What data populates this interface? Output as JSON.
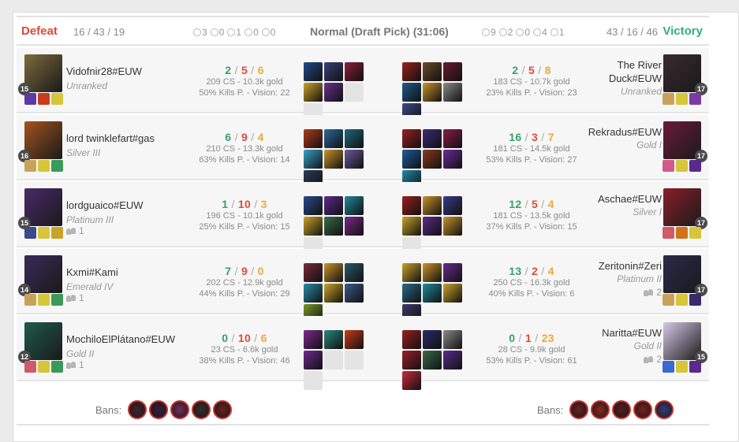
{
  "header": {
    "left_result": "Defeat",
    "left_kda": "16 / 43 / 19",
    "left_objectives": [
      "3",
      "0",
      "1",
      "0",
      "0"
    ],
    "game_mode": "Normal (Draft Pick) (31:06)",
    "right_objectives": [
      "9",
      "2",
      "0",
      "4",
      "1"
    ],
    "right_kda": "43 / 16 / 46",
    "right_result": "Victory"
  },
  "rows": [
    {
      "left": {
        "level": "15",
        "name": "Vidofnir28#EUW",
        "rank": "Unranked",
        "party": "",
        "kills": "2",
        "deaths": "5",
        "assists": "6",
        "cs": "209 CS - 10.3k gold",
        "kp": "50% Kills P. - Vision: 22",
        "champ_color": "#7d6a3c",
        "spells": [
          "#5b3aa8",
          "#c83c1c",
          "#d7c53a"
        ],
        "items": [
          "#1f4a8a",
          "#3b3f7a",
          "#8e1e3a",
          "#c9a22a",
          "#6a3090",
          "",
          ""
        ]
      },
      "right": {
        "level": "17",
        "name": "The River",
        "name2": "Duck#EUW",
        "rank": "Unranked",
        "party": "",
        "kills": "2",
        "deaths": "5",
        "assists": "8",
        "cs": "183 CS - 10.7k gold",
        "kp": "23% Kills P. - Vision: 23",
        "champ_color": "#3a2a30",
        "spells": [
          "#c9a25a",
          "#d7c53a",
          "#7a3aa8"
        ],
        "items": [
          "#9a1f1f",
          "#6a4a2a",
          "#6a1a2a",
          "#1f5a8a",
          "#c9932a",
          "#8a8a8a",
          "#3a4a8a"
        ]
      }
    },
    {
      "left": {
        "level": "16",
        "name": "lord twinklefart#gas",
        "rank": "Silver III",
        "party": "",
        "kills": "6",
        "deaths": "9",
        "assists": "4",
        "cs": "210 CS - 13.3k gold",
        "kp": "63% Kills P. - Vision: 14",
        "champ_color": "#a2531c",
        "spells": [
          "#c9a25a",
          "#d7c53a",
          "#3a9a5a"
        ],
        "items": [
          "#b03a1a",
          "#2a6a9a",
          "#1f6a7a",
          "#3aa0c8",
          "#c9932a",
          "#6a5a9a",
          "#2a3a5a"
        ]
      },
      "right": {
        "level": "17",
        "name": "Rekradus#EUW",
        "rank": "Gold I",
        "party": "",
        "kills": "16",
        "deaths": "3",
        "assists": "7",
        "cs": "181 CS - 14.5k gold",
        "kp": "53% Kills P. - Vision: 27",
        "champ_color": "#6a1a3a",
        "spells": [
          "#d05a8a",
          "#d7c53a",
          "#5a2a8a"
        ],
        "items": [
          "#9a1f1f",
          "#3a2a7a",
          "#8a1a4a",
          "#1f5a9a",
          "#8a3a1f",
          "#6a2a9a",
          "#1f8aa8"
        ]
      }
    },
    {
      "left": {
        "level": "15",
        "name": "lordguaico#EUW",
        "rank": "Platinum III",
        "party": "1",
        "kills": "1",
        "deaths": "10",
        "assists": "3",
        "cs": "196 CS - 10.1k gold",
        "kp": "25% Kills P. - Vision: 15",
        "champ_color": "#4a2a6a",
        "spells": [
          "#3a4a8a",
          "#d7c53a",
          "#c9a22a"
        ],
        "items": [
          "#2a4a8a",
          "#5a2a8a",
          "#1f8a9a",
          "#c9a22a",
          "#3a6a4a",
          "#7a2a8a",
          ""
        ]
      },
      "right": {
        "level": "17",
        "name": "Aschae#EUW",
        "rank": "Silver I",
        "party": "",
        "kills": "12",
        "deaths": "5",
        "assists": "4",
        "cs": "181 CS - 13.5k gold",
        "kp": "37% Kills P. - Vision: 15",
        "champ_color": "#8a1f2a",
        "spells": [
          "#d05a6a",
          "#d0741c",
          "#d7c53a"
        ],
        "items": [
          "#9a1f1f",
          "#c9932a",
          "#3a3a8a",
          "#c9a22a",
          "#5a2a8a",
          "#c9932a",
          ""
        ]
      }
    },
    {
      "left": {
        "level": "14",
        "name": "Kxmi#Kami",
        "rank": "Emerald IV",
        "party": "1",
        "kills": "7",
        "deaths": "9",
        "assists": "0",
        "cs": "202 CS - 12.9k gold",
        "kp": "44% Kills P. - Vision: 29",
        "champ_color": "#3a2a5a",
        "spells": [
          "#c9a25a",
          "#d7c53a",
          "#3a9a5a"
        ],
        "items": [
          "#7a2a3a",
          "#c9932a",
          "#2a5a6a",
          "#2a8aa8",
          "#c9a22a",
          "#3a5a8a",
          "#7a9a2a"
        ]
      },
      "right": {
        "level": "17",
        "name": "Zeritonin#Zeri",
        "rank": "Platinum II",
        "party": "2",
        "kills": "13",
        "deaths": "2",
        "assists": "4",
        "cs": "250 CS - 16.3k gold",
        "kp": "40% Kills P. - Vision: 6",
        "champ_color": "#2a2a4a",
        "spells": [
          "#c9a25a",
          "#d7c53a",
          "#3a2a6a"
        ],
        "items": [
          "#c9a22a",
          "#c9932a",
          "#6a2a8a",
          "#2a6a8a",
          "#1f8a9a",
          "#c9a22a",
          "#3a3a6a"
        ]
      }
    },
    {
      "left": {
        "level": "12",
        "name": "MochiloElPlátano#EUW",
        "rank": "Gold II",
        "party": "1",
        "kills": "0",
        "deaths": "10",
        "assists": "6",
        "cs": "23 CS - 6.6k gold",
        "kp": "38% Kills P. - Vision: 46",
        "champ_color": "#1f5a4a",
        "spells": [
          "#d05a6a",
          "#d7c53a",
          "#3a9a5a"
        ],
        "items": [
          "#7a2a8a",
          "#2a8a7a",
          "#c83c1c",
          "#6a2a8a",
          "",
          "",
          ""
        ]
      },
      "right": {
        "level": "15",
        "name": "Naritta#EUW",
        "rank": "Gold II",
        "party": "2",
        "kills": "0",
        "deaths": "1",
        "assists": "23",
        "cs": "28 CS - 9.9k gold",
        "kp": "53% Kills P. - Vision: 61",
        "champ_color": "#d8c8e8",
        "spells": [
          "#3a6ad0",
          "#d7c53a",
          "#5a2a8a"
        ],
        "items": [
          "#9a1f1f",
          "#2a2a6a",
          "#8a8a8a",
          "#9a1f2a",
          "#3a6a4a",
          "#5a2a8a",
          "#c82a3a"
        ]
      }
    }
  ],
  "bans": {
    "label": "Bans:",
    "left": [
      "#4a1f2a",
      "#3a1a3a",
      "#7a2a5a",
      "#3a2a2a",
      "#6a1f1f"
    ],
    "right": [
      "#6a1f1f",
      "#8a2a1f",
      "#5a1a1a",
      "#7a1f1f",
      "#3a3a7a"
    ]
  }
}
